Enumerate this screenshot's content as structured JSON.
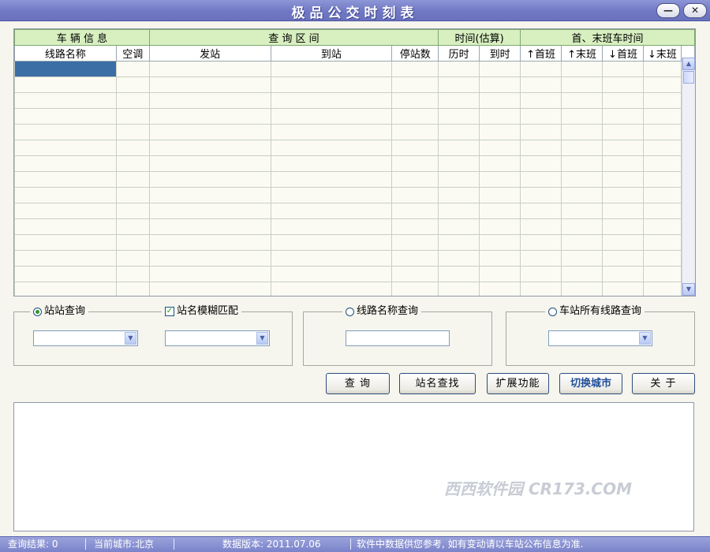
{
  "window": {
    "title": "极品公交时刻表",
    "minimize_label": "—",
    "close_label": "✕"
  },
  "table": {
    "group_headers": [
      "车 辆 信 息",
      "查  询  区  间",
      "时间(估算)",
      "首、末班车时间"
    ],
    "columns": [
      "线路名称",
      "空调",
      "发站",
      "到站",
      "停站数",
      "历时",
      "到时",
      "↑首班",
      "↑末班",
      "↓首班",
      "↓末班"
    ],
    "rows": []
  },
  "search": {
    "station_to_station": {
      "label": "站站查询",
      "selected": true
    },
    "fuzzy_match": {
      "label": "站名模糊匹配",
      "checked": true
    },
    "route_name": {
      "label": "线路名称查询",
      "selected": false
    },
    "station_all_routes": {
      "label": "车站所有线路查询",
      "selected": false
    }
  },
  "buttons": {
    "query": "查  询",
    "find_station": "站名查找",
    "extend": "扩展功能",
    "switch_city": "切换城市",
    "about": "关  于"
  },
  "icons": {
    "dropdown": "chevron-down-icon",
    "scroll_up": "arrow-up-icon",
    "scroll_down": "arrow-down-icon"
  },
  "watermark": "西西软件园 CR173.COM",
  "status": {
    "results": "查询结果: 0",
    "city": "当前城市:北京",
    "version": "数据版本: 2011.07.06",
    "notice": "软件中数据供您参考, 如有变动请以车站公布信息为准."
  },
  "colors": {
    "titlebar": "#7078c4",
    "header_green": "#d8efc0",
    "selection": "#3a6ea5",
    "accent_text": "#1f4e9a"
  }
}
